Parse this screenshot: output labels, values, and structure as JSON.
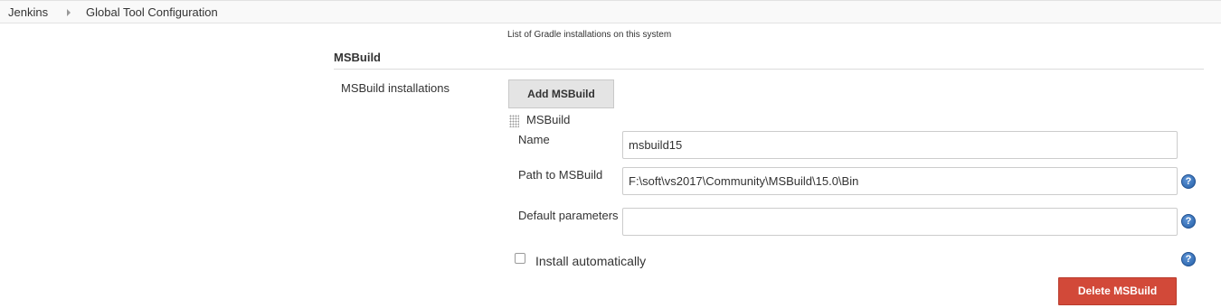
{
  "breadcrumb": {
    "items": [
      "Jenkins",
      "Global Tool Configuration"
    ]
  },
  "gradle": {
    "description": "List of Gradle installations on this system"
  },
  "msbuild": {
    "section_title": "MSBuild",
    "installations_label": "MSBuild installations",
    "add_button_label": "Add MSBuild",
    "installation": {
      "header": "MSBuild",
      "name_label": "Name",
      "name_value": "msbuild15",
      "path_label": "Path to MSBuild",
      "path_value": "F:\\soft\\vs2017\\Community\\MSBuild\\15.0\\Bin",
      "defaults_label": "Default parameters",
      "defaults_value": "",
      "install_auto_label": "Install automatically",
      "install_auto_checked": false,
      "delete_button_label": "Delete MSBuild"
    }
  },
  "icons": {
    "help": "help-icon",
    "drag": "drag-handle-icon",
    "breadcrumb_separator": "chevron-right-icon"
  },
  "colors": {
    "delete_button": "#d24939",
    "add_button": "#e4e4e4",
    "help_icon": "#245fa8",
    "breadcrumb_bar": "#f9f9f9"
  }
}
